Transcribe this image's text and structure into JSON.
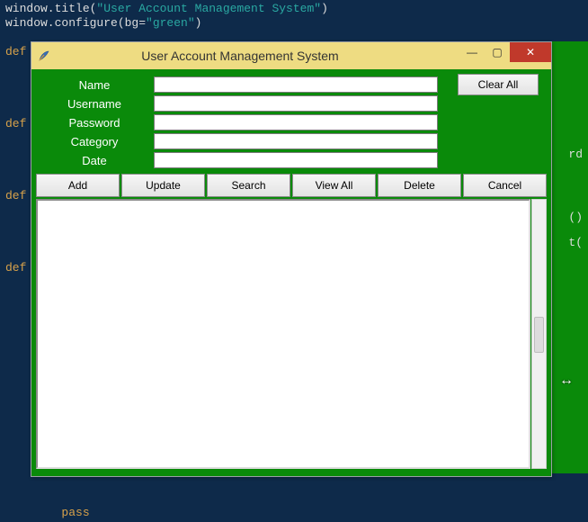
{
  "code_background": {
    "line1_pre": "window.title(",
    "line1_str": "\"User Account Management System\"",
    "line1_post": ")",
    "line2_pre": "window.configure(bg=",
    "line2_str": "\"green\"",
    "line2_post": ")",
    "def_kw": "def",
    "pass_kw": "pass",
    "frag_rd": "rd",
    "frag_paren": "()",
    "frag_t": "t("
  },
  "window": {
    "title": "User Account Management System",
    "controls": {
      "minimize": "—",
      "maximize": "▢",
      "close": "✕"
    }
  },
  "form": {
    "labels": {
      "name": "Name",
      "username": "Username",
      "password": "Password",
      "category": "Category",
      "date": "Date"
    },
    "values": {
      "name": "",
      "username": "",
      "password": "",
      "category": "",
      "date": ""
    },
    "clear_all": "Clear All"
  },
  "toolbar": {
    "add": "Add",
    "update": "Update",
    "search": "Search",
    "view_all": "View All",
    "delete": "Delete",
    "cancel": "Cancel"
  },
  "cursor_glyph": "↔"
}
